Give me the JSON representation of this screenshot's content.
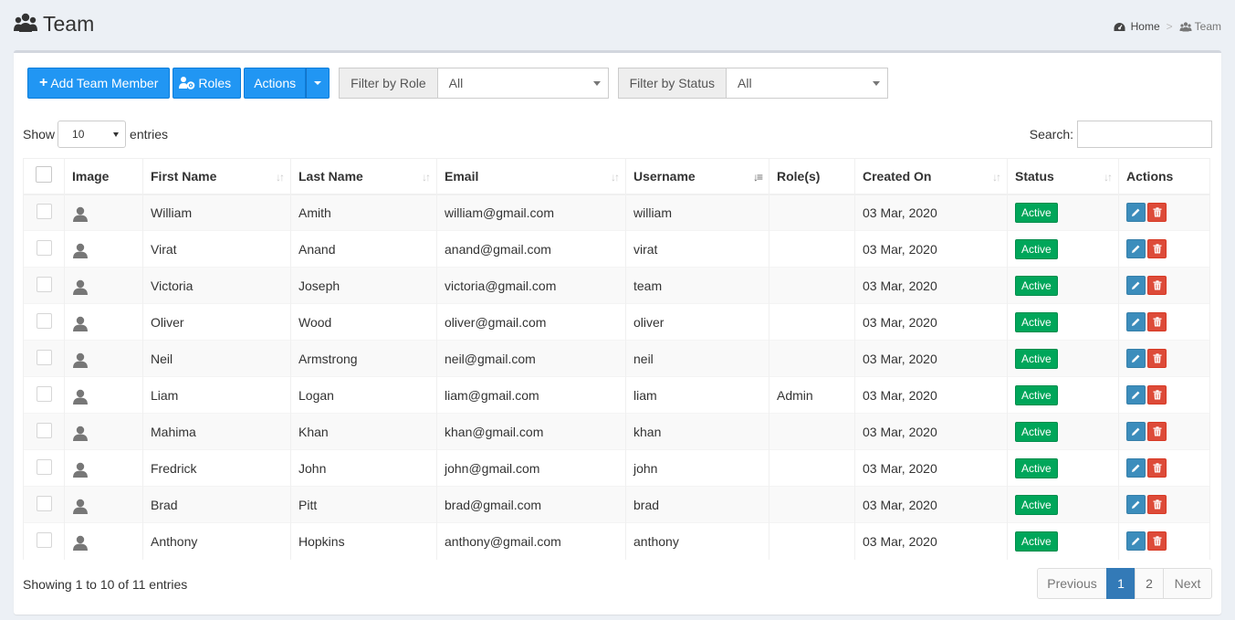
{
  "header": {
    "title": "Team"
  },
  "breadcrumb": {
    "home": "Home",
    "separator": ">",
    "current": "Team"
  },
  "toolbar": {
    "add_label": "Add Team Member",
    "roles_label": "Roles",
    "actions_label": "Actions"
  },
  "filters": {
    "role": {
      "label": "Filter by Role",
      "value": "All"
    },
    "status": {
      "label": "Filter by Status",
      "value": "All"
    }
  },
  "length": {
    "show": "Show",
    "value": "10",
    "entries": "entries"
  },
  "search": {
    "label": "Search:",
    "value": ""
  },
  "table": {
    "columns": [
      "Image",
      "First Name",
      "Last Name",
      "Email",
      "Username",
      "Role(s)",
      "Created On",
      "Status",
      "Actions"
    ],
    "rows": [
      {
        "first": "William",
        "last": "Amith",
        "email": "william@gmail.com",
        "username": "william",
        "roles": "",
        "created": "03 Mar, 2020",
        "status": "Active"
      },
      {
        "first": "Virat",
        "last": "Anand",
        "email": "anand@gmail.com",
        "username": "virat",
        "roles": "",
        "created": "03 Mar, 2020",
        "status": "Active"
      },
      {
        "first": "Victoria",
        "last": "Joseph",
        "email": "victoria@gmail.com",
        "username": "team",
        "roles": "",
        "created": "03 Mar, 2020",
        "status": "Active"
      },
      {
        "first": "Oliver",
        "last": "Wood",
        "email": "oliver@gmail.com",
        "username": "oliver",
        "roles": "",
        "created": "03 Mar, 2020",
        "status": "Active"
      },
      {
        "first": "Neil",
        "last": "Armstrong",
        "email": "neil@gmail.com",
        "username": "neil",
        "roles": "",
        "created": "03 Mar, 2020",
        "status": "Active"
      },
      {
        "first": "Liam",
        "last": "Logan",
        "email": "liam@gmail.com",
        "username": "liam",
        "roles": "Admin",
        "created": "03 Mar, 2020",
        "status": "Active"
      },
      {
        "first": "Mahima",
        "last": "Khan",
        "email": "khan@gmail.com",
        "username": "khan",
        "roles": "",
        "created": "03 Mar, 2020",
        "status": "Active"
      },
      {
        "first": "Fredrick",
        "last": "John",
        "email": "john@gmail.com",
        "username": "john",
        "roles": "",
        "created": "03 Mar, 2020",
        "status": "Active"
      },
      {
        "first": "Brad",
        "last": "Pitt",
        "email": "brad@gmail.com",
        "username": "brad",
        "roles": "",
        "created": "03 Mar, 2020",
        "status": "Active"
      },
      {
        "first": "Anthony",
        "last": "Hopkins",
        "email": "anthony@gmail.com",
        "username": "anthony",
        "roles": "",
        "created": "03 Mar, 2020",
        "status": "Active"
      }
    ]
  },
  "footer": {
    "info": "Showing 1 to 10 of 11 entries",
    "prev": "Previous",
    "pages": [
      "1",
      "2"
    ],
    "current_page": "1",
    "next": "Next"
  },
  "colors": {
    "primary": "#2196f3",
    "success": "#00a65a",
    "danger": "#dd4b39",
    "edit": "#3c8dbc",
    "page_active": "#337ab7"
  }
}
